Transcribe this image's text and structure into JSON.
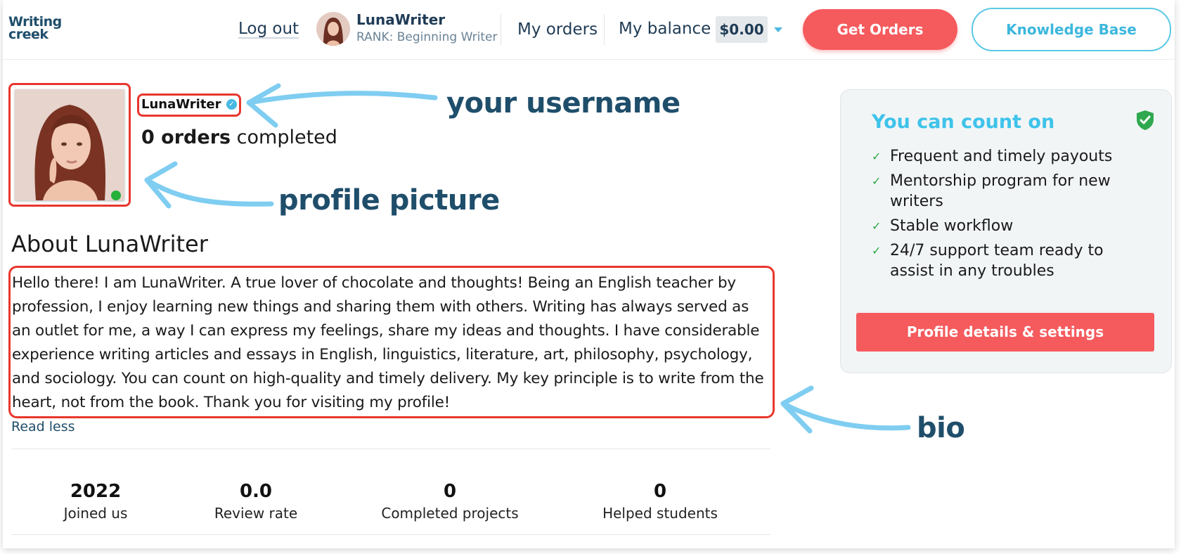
{
  "header": {
    "logo_line1": "Writing",
    "logo_line2": "creek",
    "logout": "Log out",
    "username": "LunaWriter",
    "rank": "RANK: Beginning Writer",
    "my_orders": "My orders",
    "my_balance": "My balance",
    "balance": "$0.00",
    "get_orders": "Get Orders",
    "knowledge_base": "Knowledge Base"
  },
  "profile": {
    "username": "LunaWriter",
    "orders_count": "0 orders",
    "orders_suffix": "completed",
    "online": true
  },
  "about": {
    "title": "About LunaWriter",
    "bio": "Hello there!  I am LunaWriter. A true lover of chocolate and thoughts! Being an English teacher by profession, I enjoy learning new things and sharing them with others. Writing has always served as an outlet for me, a way I can express my feelings, share my ideas and thoughts. I have considerable experience writing articles and essays in English, linguistics, literature, art, philosophy, psychology, and sociology. You can count on high-quality and timely delivery. My key principle is to write from the heart, not from the book.  Thank you for visiting my profile!",
    "read_less": "Read less"
  },
  "stats": [
    {
      "value": "2022",
      "label": "Joined us"
    },
    {
      "value": "0.0",
      "label": "Review rate"
    },
    {
      "value": "0",
      "label": "Completed projects"
    },
    {
      "value": "0",
      "label": "Helped students"
    }
  ],
  "card": {
    "title": "You can count on",
    "items": [
      "Frequent and timely payouts",
      "Mentorship program for new writers",
      "Stable workflow",
      "24/7 support team ready to assist in any troubles"
    ],
    "button": "Profile details & settings"
  },
  "annotations": {
    "username": "your username",
    "picture": "profile picture",
    "bio": "bio"
  },
  "colors": {
    "accent_red": "#f55a5d",
    "accent_blue": "#5bc8e6",
    "annotation_text": "#1f4e6b",
    "highlight_red": "#e8372d",
    "online_green": "#27b13a"
  }
}
